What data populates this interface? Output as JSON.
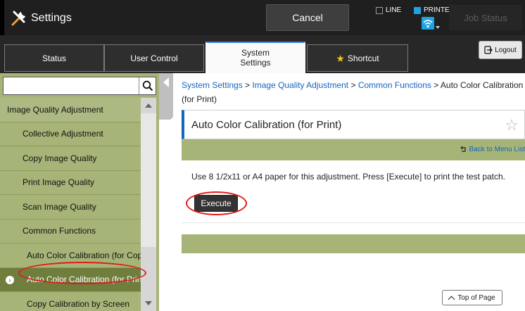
{
  "header": {
    "app_title": "Settings",
    "app_icon": "tools-icon",
    "cancel_label": "Cancel",
    "line_label": "LINE",
    "printer_label": "PRINTER",
    "job_status_label": "Job Status",
    "accent_color": "#1fa3e0"
  },
  "tabs": {
    "status": "Status",
    "user_control": "User Control",
    "system_settings": "System\nSettings",
    "shortcut": "Shortcut",
    "active": "system_settings"
  },
  "logout_label": "Logout",
  "sidebar": {
    "search_placeholder": "",
    "search_value": "",
    "items": [
      {
        "label": "Image Quality Adjustment",
        "level": 1
      },
      {
        "label": "Collective Adjustment",
        "level": 2
      },
      {
        "label": "Copy Image Quality",
        "level": 2
      },
      {
        "label": "Print Image Quality",
        "level": 2
      },
      {
        "label": "Scan Image Quality",
        "level": 2
      },
      {
        "label": "Common Functions",
        "level": 2
      },
      {
        "label": "Auto Color Calibration (for Copy)",
        "level": 3
      },
      {
        "label": "Auto Color Calibration (for Print)",
        "level": 3,
        "selected": true
      },
      {
        "label": "Copy Calibration by Screen",
        "level": 3
      }
    ],
    "background_color": "#a7b477",
    "selected_color": "#6f7d3d"
  },
  "breadcrumb": {
    "crumbs": [
      "System Settings",
      "Image Quality Adjustment",
      "Common Functions"
    ],
    "separator": ">",
    "current": "Auto Color Calibration (for Print)"
  },
  "main": {
    "title": "Auto Color Calibration (for Print)",
    "back_label": "Back to Menu List",
    "instruction": "Use 8 1/2x11 or A4 paper for this adjustment. Press [Execute] to print the test patch.",
    "execute_label": "Execute",
    "top_of_page_label": "Top of Page",
    "link_color": "#1565c0"
  }
}
